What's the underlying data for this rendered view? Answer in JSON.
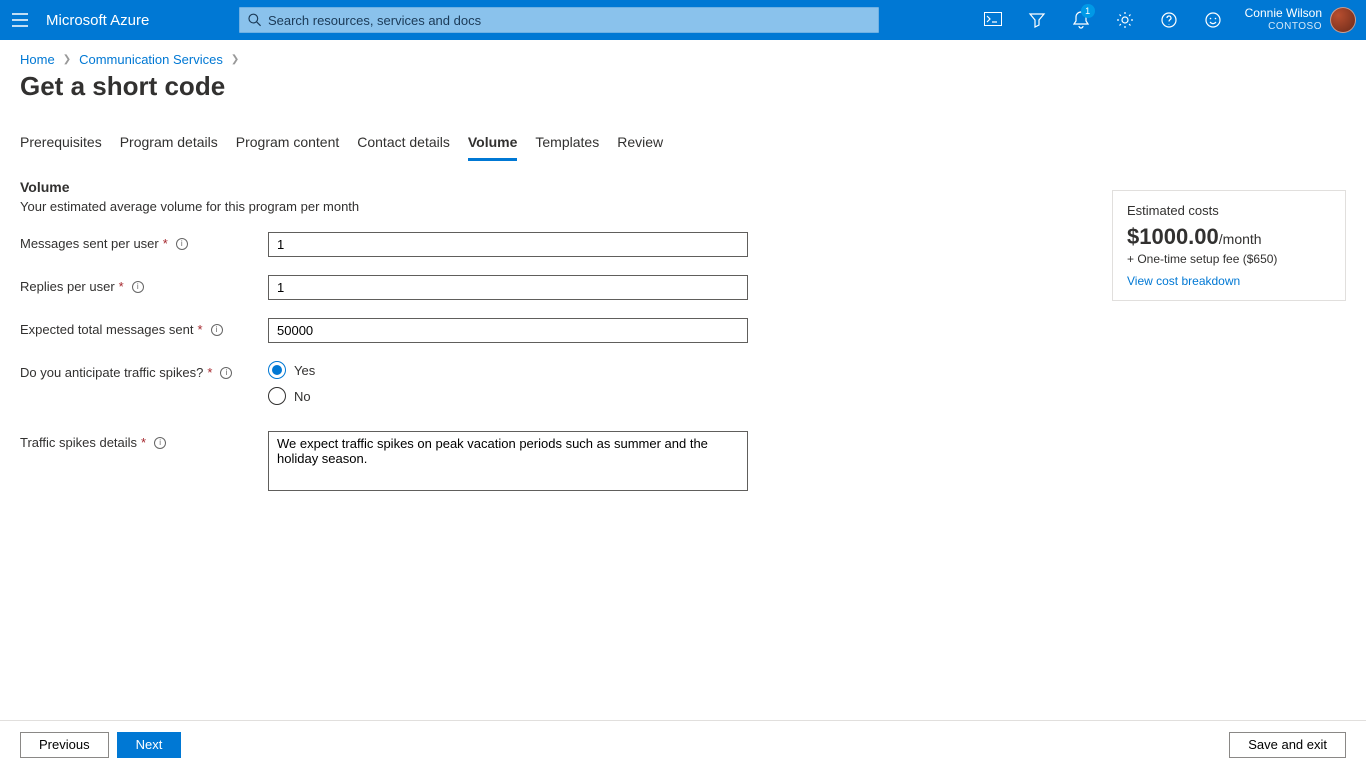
{
  "header": {
    "brand": "Microsoft Azure",
    "search_placeholder": "Search resources, services and docs",
    "notification_count": "1",
    "user_name": "Connie Wilson",
    "directory": "CONTOSO"
  },
  "breadcrumbs": {
    "items": [
      {
        "label": "Home"
      },
      {
        "label": "Communication Services"
      }
    ]
  },
  "page": {
    "title": "Get a short code"
  },
  "tabs": [
    {
      "label": "Prerequisites",
      "active": false
    },
    {
      "label": "Program details",
      "active": false
    },
    {
      "label": "Program content",
      "active": false
    },
    {
      "label": "Contact details",
      "active": false
    },
    {
      "label": "Volume",
      "active": true
    },
    {
      "label": "Templates",
      "active": false
    },
    {
      "label": "Review",
      "active": false
    }
  ],
  "form": {
    "section_heading": "Volume",
    "section_sub": "Your estimated average volume for this program per month",
    "messages_per_user": {
      "label": "Messages sent per user",
      "value": "1"
    },
    "replies_per_user": {
      "label": "Replies per user",
      "value": "1"
    },
    "expected_total": {
      "label": "Expected total messages sent",
      "value": "50000"
    },
    "traffic_spikes": {
      "label": "Do you anticipate traffic spikes?",
      "options": {
        "yes": "Yes",
        "no": "No"
      },
      "selected": "yes"
    },
    "spikes_details": {
      "label": "Traffic spikes details",
      "value": "We expect traffic spikes on peak vacation periods such as summer and the holiday season."
    }
  },
  "cost_card": {
    "title": "Estimated costs",
    "amount": "$1000.00",
    "unit": "/month",
    "fee": "+ One-time setup fee ($650)",
    "link": "View cost breakdown"
  },
  "footer": {
    "previous": "Previous",
    "next": "Next",
    "save_exit": "Save and exit"
  }
}
